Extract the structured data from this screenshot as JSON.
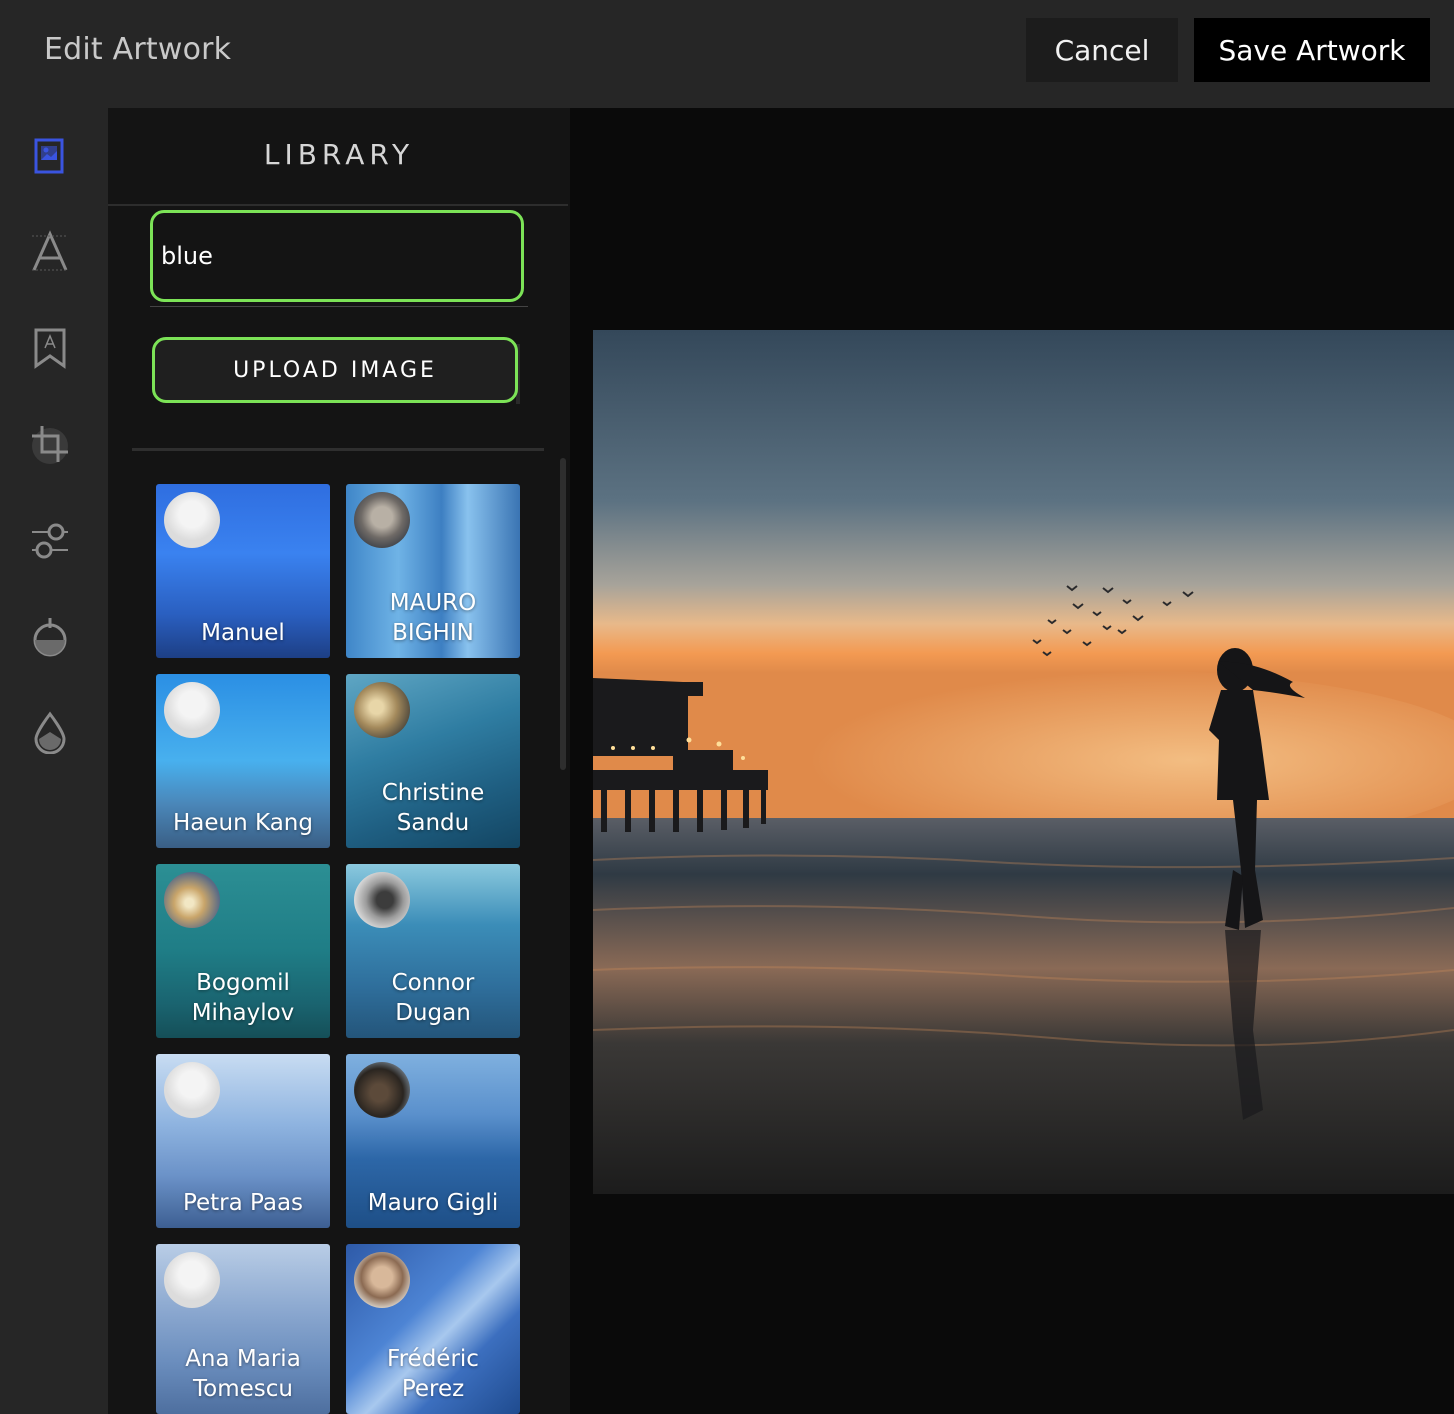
{
  "header": {
    "title": "Edit Artwork",
    "cancel_label": "Cancel",
    "save_label": "Save Artwork"
  },
  "toolbar": {
    "tools": [
      "image-tool-icon",
      "text-tool-icon",
      "bookmark-tool-icon",
      "crop-tool-icon",
      "adjust-tool-icon",
      "filter-tool-icon",
      "color-drop-tool-icon"
    ],
    "active_tool": "image-tool-icon",
    "active_color": "#3a54e0"
  },
  "library": {
    "title": "LIBRARY",
    "search_value": "blue",
    "upload_label": "UPLOAD IMAGE",
    "accent_color": "#7ce357",
    "items": [
      {
        "name": "Manuel"
      },
      {
        "name": "MAURO\nBIGHIN"
      },
      {
        "name": "Haeun Kang"
      },
      {
        "name": "Christine\nSandu"
      },
      {
        "name": "Bogomil\nMihaylov"
      },
      {
        "name": "Connor\nDugan"
      },
      {
        "name": "Petra Paas"
      },
      {
        "name": "Mauro Gigli"
      },
      {
        "name": "Ana Maria\nTomescu"
      },
      {
        "name": "Frédéric\nPerez"
      }
    ]
  }
}
